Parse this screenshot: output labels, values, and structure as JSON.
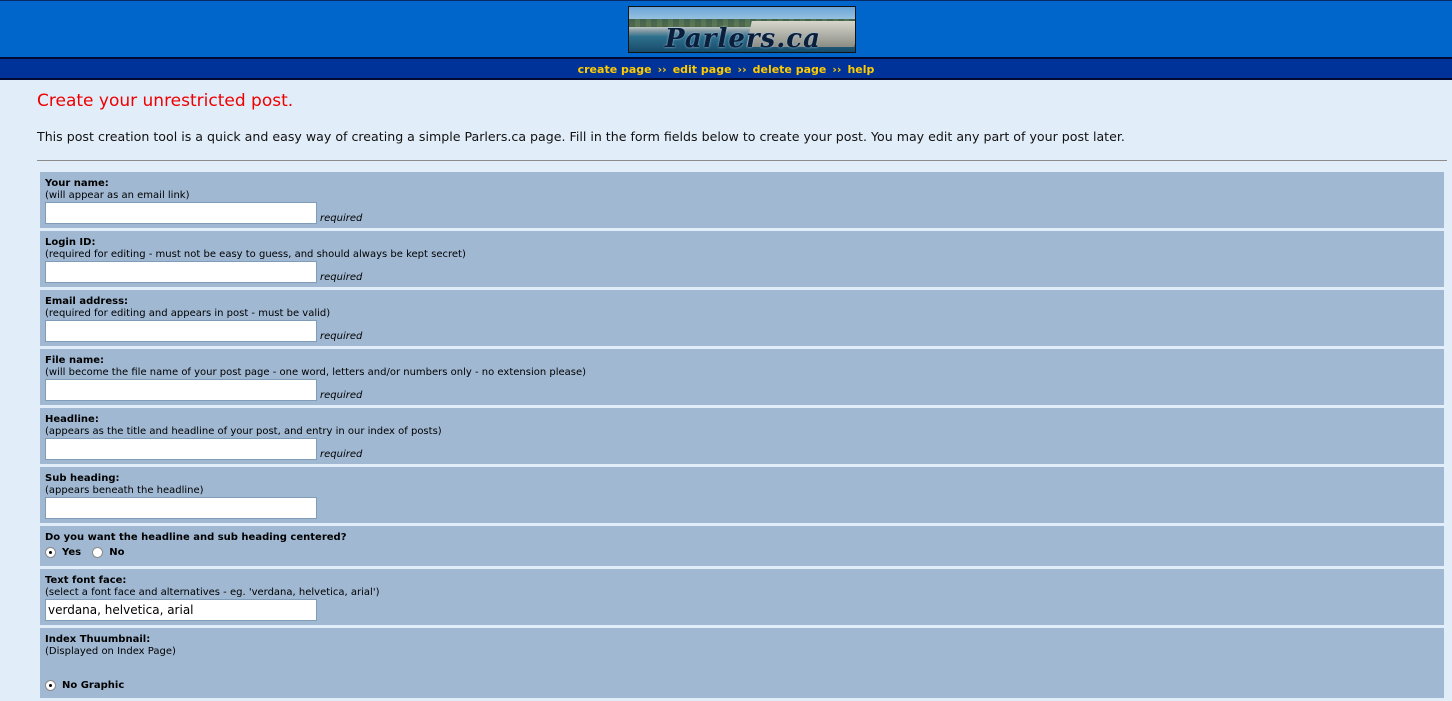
{
  "header": {
    "logo_text": "Parlers.ca"
  },
  "nav": {
    "items": [
      "create page",
      "edit page",
      "delete page",
      "help"
    ],
    "separator": "››"
  },
  "page": {
    "title": "Create your unrestricted post.",
    "intro": "This post creation tool is a quick and easy way of creating a simple Parlers.ca page. Fill in the form fields below to create your post. You may edit any part of your post later."
  },
  "form": {
    "required_label": "required",
    "fields": [
      {
        "label": "Your name:",
        "hint": "(will appear as an email link)",
        "value": ""
      },
      {
        "label": "Login ID:",
        "hint": "(required for editing - must not be easy to guess, and should always be kept secret)",
        "value": ""
      },
      {
        "label": "Email address:",
        "hint": "(required for editing and appears in post - must be valid)",
        "value": ""
      },
      {
        "label": "File name:",
        "hint": "(will become the file name of your post page - one word, letters and/or numbers only - no extension please)",
        "value": ""
      },
      {
        "label": "Headline:",
        "hint": "(appears as the title and headline of your post, and entry in our index of posts)",
        "value": ""
      },
      {
        "label": "Sub heading:",
        "hint": "(appears beneath the headline)",
        "value": ""
      }
    ],
    "centered": {
      "label": "Do you want the headline and sub heading centered?",
      "options": [
        "Yes",
        "No"
      ],
      "selected": "Yes"
    },
    "font_face": {
      "label": "Text font face:",
      "hint": "(select a font face and alternatives - eg. 'verdana, helvetica, arial')",
      "value": "verdana, helvetica, arial"
    },
    "thumbnail": {
      "label": "Index Thuumbnail:",
      "hint": "(Displayed on Index Page)",
      "option": "No Graphic"
    }
  }
}
